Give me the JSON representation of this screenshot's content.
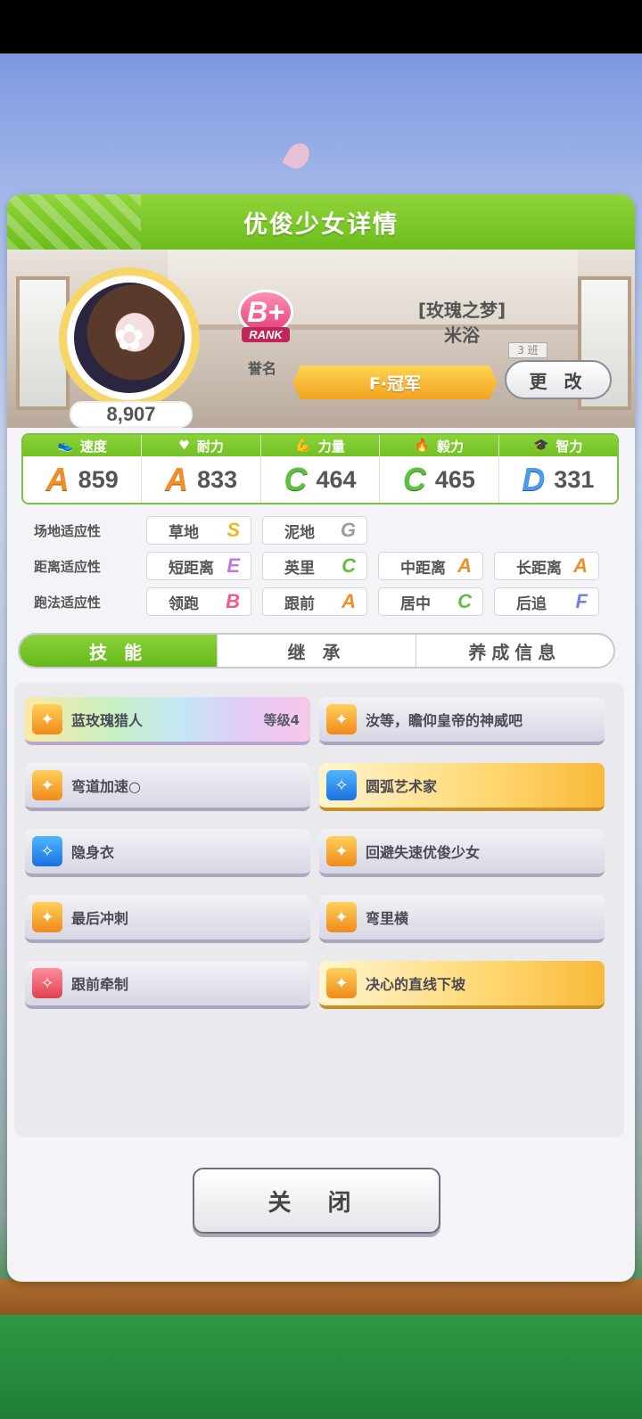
{
  "dialog": {
    "title": "优俊少女详情"
  },
  "profile": {
    "score": "8,907",
    "rank_grade": "B+",
    "rank_word": "RANK",
    "rank_caption": "誉名",
    "subtitle": "[玫瑰之梦]",
    "name": "米浴",
    "class_tag": "3 班",
    "title_banner": "F·冠军",
    "change_label": "更 改"
  },
  "stats": [
    {
      "label": "速度",
      "icon": "shoe-icon",
      "grade": "A",
      "value": "859"
    },
    {
      "label": "耐力",
      "icon": "heart-icon",
      "grade": "A",
      "value": "833"
    },
    {
      "label": "力量",
      "icon": "muscle-icon",
      "grade": "C",
      "value": "464"
    },
    {
      "label": "毅力",
      "icon": "flame-icon",
      "grade": "C",
      "value": "465"
    },
    {
      "label": "智力",
      "icon": "graduation-cap-icon",
      "grade": "D",
      "value": "331"
    }
  ],
  "aptitude": {
    "track": {
      "label": "场地适应性",
      "items": [
        {
          "name": "草地",
          "grade": "S"
        },
        {
          "name": "泥地",
          "grade": "G"
        }
      ]
    },
    "distance": {
      "label": "距离适应性",
      "items": [
        {
          "name": "短距离",
          "grade": "E"
        },
        {
          "name": "英里",
          "grade": "C"
        },
        {
          "name": "中距离",
          "grade": "A"
        },
        {
          "name": "长距离",
          "grade": "A"
        }
      ]
    },
    "style": {
      "label": "跑法适应性",
      "items": [
        {
          "name": "领跑",
          "grade": "B"
        },
        {
          "name": "跟前",
          "grade": "A"
        },
        {
          "name": "居中",
          "grade": "C"
        },
        {
          "name": "后追",
          "grade": "F"
        }
      ]
    }
  },
  "tabs": [
    "技 能",
    "继 承",
    "养成信息"
  ],
  "skills": [
    {
      "name": "蓝玫瑰猎人",
      "level": "等级4",
      "style": "rainbow",
      "icon_color": "orange"
    },
    {
      "name": "汝等，瞻仰皇帝的神威吧",
      "level": "",
      "style": "normal",
      "icon_color": "orange"
    },
    {
      "name": "弯道加速○",
      "level": "",
      "style": "normal",
      "icon_color": "orange"
    },
    {
      "name": "圆弧艺术家",
      "level": "",
      "style": "gold",
      "icon_color": "blue"
    },
    {
      "name": "隐身衣",
      "level": "",
      "style": "normal",
      "icon_color": "blue"
    },
    {
      "name": "回避失速优俊少女",
      "level": "",
      "style": "normal",
      "icon_color": "orange"
    },
    {
      "name": "最后冲刺",
      "level": "",
      "style": "normal",
      "icon_color": "orange"
    },
    {
      "name": "弯里横",
      "level": "",
      "style": "normal",
      "icon_color": "orange"
    },
    {
      "name": "跟前牵制",
      "level": "",
      "style": "normal",
      "icon_color": "red"
    },
    {
      "name": "决心的直线下坡",
      "level": "",
      "style": "gold",
      "icon_color": "orange"
    }
  ],
  "close_label": "关 闭"
}
